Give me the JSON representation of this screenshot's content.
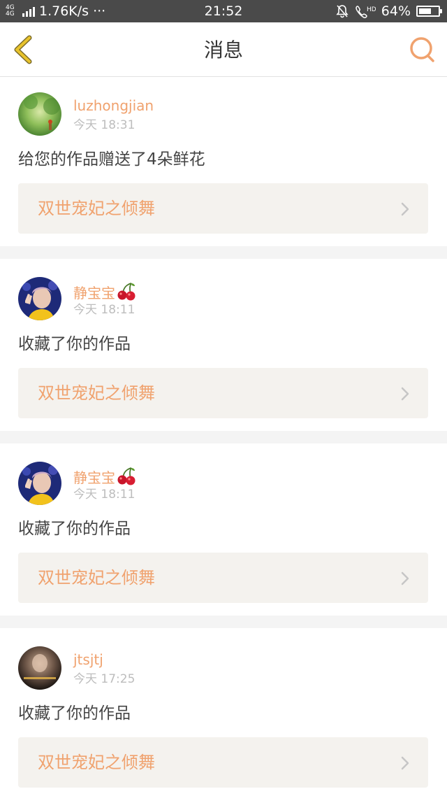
{
  "status_bar": {
    "network": "4G 4G",
    "speed": "1.76K/s",
    "dots": "···",
    "time": "21:52",
    "battery": "64%",
    "battery_level": 0.64,
    "icons": [
      "signal-icon",
      "mute-bell-icon",
      "hd-call-icon",
      "battery-icon"
    ]
  },
  "header": {
    "title": "消息",
    "back_icon": "chevron-left-icon",
    "search_icon": "search-icon",
    "accent_back": "#e8c32c",
    "accent_search": "#f0a26e"
  },
  "colors": {
    "username": "#f0a26e",
    "time": "#bdbdbd",
    "text": "#444444",
    "card_bg": "#f4f2ee"
  },
  "messages": [
    {
      "username": "luzhongjian",
      "badge": "",
      "time": "今天 18:31",
      "text": "给您的作品赠送了4朵鲜花",
      "work": "双世宠妃之倾舞",
      "avatar": "nature-avatar"
    },
    {
      "username": "静宝宝",
      "badge": "cherry",
      "time": "今天 18:11",
      "text": "收藏了你的作品",
      "work": "双世宠妃之倾舞",
      "avatar": "portrait-avatar"
    },
    {
      "username": "静宝宝",
      "badge": "cherry",
      "time": "今天 18:11",
      "text": "收藏了你的作品",
      "work": "双世宠妃之倾舞",
      "avatar": "portrait-avatar"
    },
    {
      "username": "jtsjtj",
      "badge": "",
      "time": "今天 17:25",
      "text": "收藏了你的作品",
      "work": "双世宠妃之倾舞",
      "avatar": "dark-avatar"
    }
  ]
}
